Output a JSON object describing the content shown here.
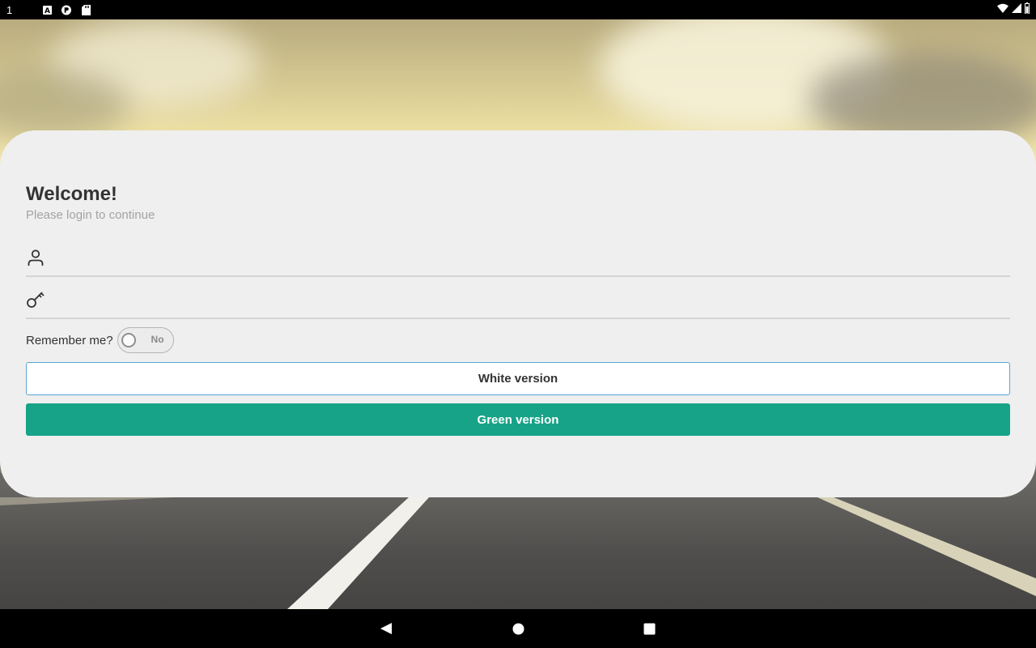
{
  "status_bar": {
    "time": "1",
    "notification_icons": [
      "a-box-icon",
      "pocket-icon",
      "sd-card-icon"
    ],
    "right_icons": [
      "wifi-icon",
      "signal-icon",
      "battery-icon"
    ]
  },
  "card": {
    "title": "Welcome!",
    "subtitle": "Please login to continue",
    "username_field": {
      "icon": "user-icon",
      "value": "",
      "placeholder": ""
    },
    "password_field": {
      "icon": "key-icon",
      "value": "",
      "placeholder": ""
    },
    "remember": {
      "label": "Remember me?",
      "toggle_text": "No",
      "checked": false
    },
    "buttons": {
      "white_label": "White version",
      "green_label": "Green version"
    }
  },
  "colors": {
    "accent_green": "#17a387",
    "outline_blue": "#58a6d6",
    "card_bg": "#efefef"
  },
  "nav_bar": {
    "icons": [
      "back-icon",
      "home-icon",
      "recents-icon"
    ]
  }
}
